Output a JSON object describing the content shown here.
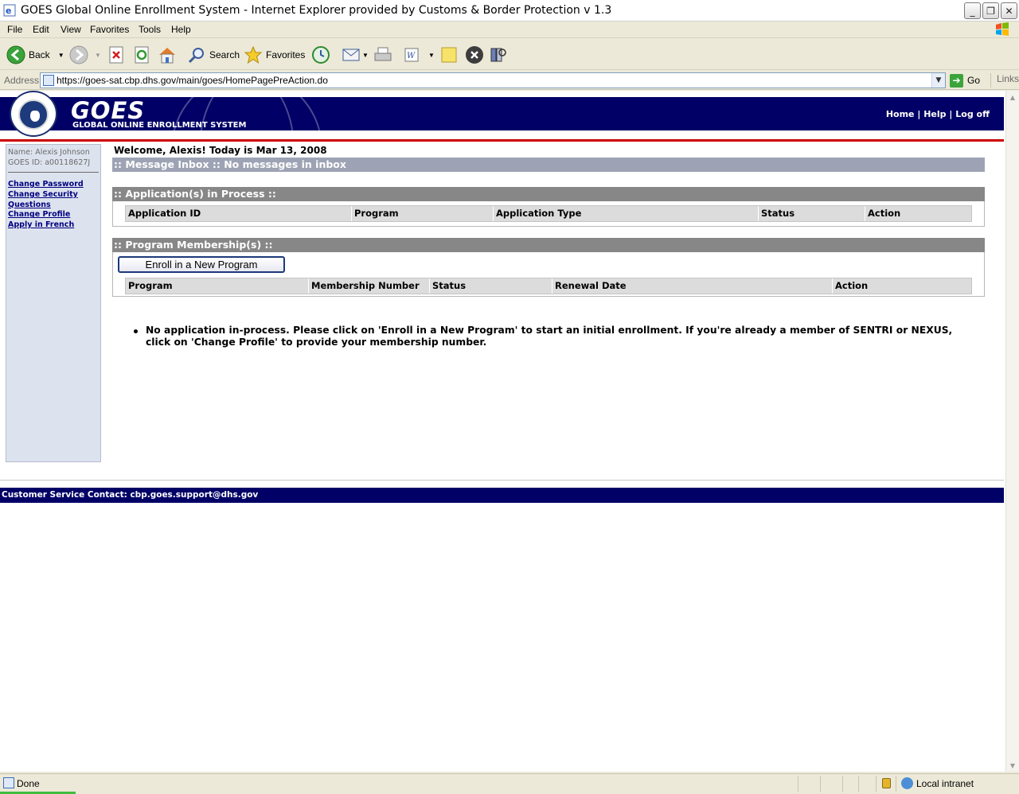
{
  "window": {
    "title": "GOES Global Online Enrollment System - Internet Explorer provided by Customs & Border Protection v 1.3",
    "controls": [
      "minimize",
      "maximize",
      "close"
    ]
  },
  "menubar": {
    "items": [
      "File",
      "Edit",
      "View",
      "Favorites",
      "Tools",
      "Help"
    ]
  },
  "toolbar": {
    "back_label": "Back",
    "search_label": "Search",
    "favorites_label": "Favorites"
  },
  "address": {
    "label": "Address",
    "url": "https://goes-sat.cbp.dhs.gov/main/goes/HomePagePreAction.do",
    "go_label": "Go",
    "links_label": "Links"
  },
  "banner": {
    "logo_text": "GOES",
    "subtitle": "GLOBAL ONLINE ENROLLMENT SYSTEM",
    "nav": {
      "home": "Home",
      "sep1": "|",
      "help": "Help",
      "sep2": "|",
      "logoff": "Log off"
    }
  },
  "sidebar": {
    "name_line": "Name: Alexis Johnson",
    "id_line": "GOES ID: a00118627J",
    "links": [
      "Change Password",
      "Change Security",
      "Questions",
      "Change Profile",
      "Apply in French"
    ]
  },
  "main": {
    "welcome": "Welcome, Alexis! Today is Mar 13, 2008",
    "inbox_bar": ":: Message Inbox :: No messages in inbox",
    "applications": {
      "bar": ":: Application(s) in Process ::",
      "columns": [
        "Application ID",
        "Program",
        "Application Type",
        "Status",
        "Action"
      ]
    },
    "memberships": {
      "bar": ":: Program Membership(s) ::",
      "enroll_button": "Enroll in a New Program",
      "columns": [
        "Program",
        "Membership Number",
        "Status",
        "Renewal Date",
        "Action"
      ]
    },
    "notice": "No application in-process. Please click on 'Enroll in a New Program' to start an initial enrollment. If you're already a member of SENTRI or NEXUS, click on 'Change Profile' to provide your membership number."
  },
  "footer": {
    "contact": "Customer Service Contact: cbp.goes.support@dhs.gov"
  },
  "statusbar": {
    "status": "Done",
    "zone": "Local intranet"
  },
  "colors": {
    "banner_navy": "#000066",
    "accent_red": "#cc0000",
    "sidebar_bg": "#dde3ee",
    "section_gray": "#878787",
    "inbox_bar": "#9da3b4",
    "link_blue": "#000080"
  }
}
